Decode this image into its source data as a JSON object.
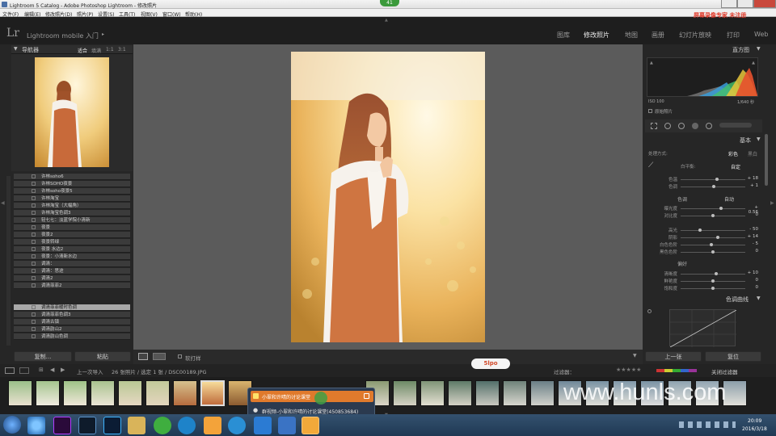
{
  "title": {
    "text": "Lightroom 5 Catalog - Adobe Photoshop Lightroom - 修改照片",
    "badge": "41"
  },
  "menu": [
    "文件(F)",
    "编辑(E)",
    "修改照片(D)",
    "照片(P)",
    "设置(S)",
    "工具(T)",
    "视图(V)",
    "窗口(W)",
    "帮助(H)"
  ],
  "identity_plate": {
    "logo": "Lr",
    "text": "Lightroom mobile 入门",
    "overlay": "屏幕录像专家 未注册"
  },
  "modules": [
    "图库",
    "修改照片",
    "地图",
    "画册",
    "幻灯片放映",
    "打印",
    "Web"
  ],
  "navigator": {
    "title": "导航器",
    "opts": [
      "适合",
      "填满",
      "1:1",
      "3:1"
    ]
  },
  "presets": [
    "许林soho6",
    "许林SOHO夜景",
    "许林soho夜景5",
    "许林淘宝",
    "许林淘宝（大幅角）",
    "许林淘宝色调3",
    "轻七七：淡蓝学院小清新",
    "夜景",
    "夜景2",
    "夜景转绿",
    "夜景 水边2",
    "夜景：小清新水边",
    "调清：",
    "调清：思途",
    "调清2",
    "调清菲菲2",
    "调清菲菲暖时色调",
    "调清菲菲色调3",
    "调清古镇",
    "调清韵山2",
    "调清韵山色调"
  ],
  "left_buttons": {
    "copy": "复制...",
    "paste": "粘贴"
  },
  "histogram": {
    "title": "直方图",
    "iso": "ISO 100",
    "shutter": "1/640 秒",
    "original": "原始照片"
  },
  "basic": {
    "title": "基本",
    "treatment_label": "处理方式:",
    "color": "彩色",
    "bw": "黑白",
    "wb_label": "白平衡:",
    "wb_value": "自定",
    "tone_title": "色调",
    "auto": "自动",
    "presence_title": "偏好",
    "sliders": [
      {
        "label": "色温",
        "value": "+ 18",
        "pos": 0.56
      },
      {
        "label": "色调",
        "value": "+ 1",
        "pos": 0.51
      },
      {
        "label": "曝光度",
        "value": "+ 0.56",
        "pos": 0.62
      },
      {
        "label": "对比度",
        "value": "0",
        "pos": 0.5
      },
      {
        "label": "高光",
        "value": "- 50",
        "pos": 0.3
      },
      {
        "label": "阴影",
        "value": "+ 14",
        "pos": 0.57
      },
      {
        "label": "白色色阶",
        "value": "- 5",
        "pos": 0.47
      },
      {
        "label": "黑色色阶",
        "value": "0",
        "pos": 0.5
      },
      {
        "label": "清晰度",
        "value": "+ 10",
        "pos": 0.55
      },
      {
        "label": "鲜艳度",
        "value": "0",
        "pos": 0.5
      },
      {
        "label": "饱和度",
        "value": "0",
        "pos": 0.5
      }
    ]
  },
  "tone_curve": {
    "title": "色调曲线"
  },
  "right_buttons": {
    "prev": "上一张",
    "reset": "复位"
  },
  "toolbar": {
    "softproof": "软打样"
  },
  "filmstrip_bar": {
    "source": "上一次导入",
    "count": "26 张照片 / 选定 1 张 / DSC00189.JPG",
    "filter_label": "过滤器：",
    "filter_value": "关闭过滤器"
  },
  "popup": {
    "item1": "小翠和许晴的讨论课堂",
    "item2": "群视频-小翠和许晴的讨论课堂(450853684)"
  },
  "watermark": "www.hunls.com",
  "watermark_badge": "5lpo",
  "clock": {
    "time": "20:09",
    "date": "2016/3/18"
  }
}
